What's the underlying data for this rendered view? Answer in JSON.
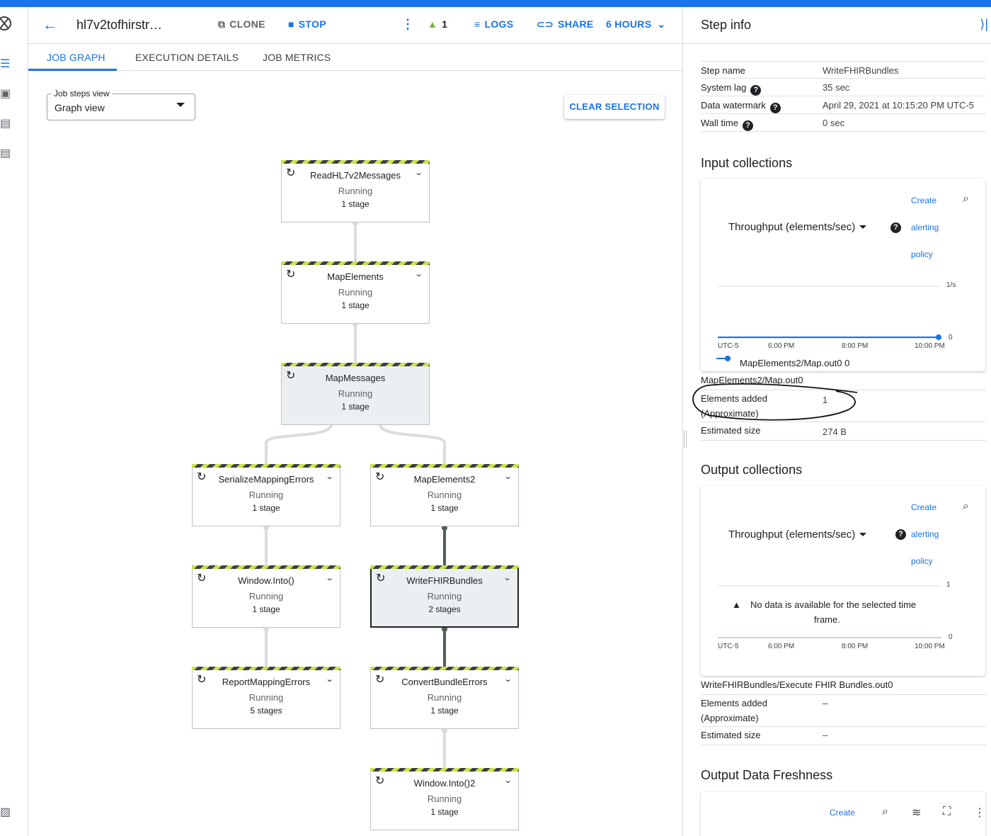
{
  "header": {
    "job_name": "hl7v2tofhirstr…",
    "clone": "CLONE",
    "stop": "STOP",
    "warning_count": "1",
    "logs": "LOGS",
    "share": "SHARE",
    "time_range": "6 HOURS"
  },
  "tabs": [
    "JOB GRAPH",
    "EXECUTION DETAILS",
    "JOB METRICS"
  ],
  "graph": {
    "view_label": "Job steps view",
    "view_value": "Graph view",
    "clear_selection": "CLEAR SELECTION",
    "nodes": [
      {
        "name": "ReadHL7v2Messages",
        "status": "Running",
        "stages": "1 stage"
      },
      {
        "name": "MapElements",
        "status": "Running",
        "stages": "1 stage"
      },
      {
        "name": "MapMessages",
        "status": "Running",
        "stages": "1 stage"
      },
      {
        "name": "SerializeMappingErrors",
        "status": "Running",
        "stages": "1 stage"
      },
      {
        "name": "MapElements2",
        "status": "Running",
        "stages": "1 stage"
      },
      {
        "name": "Window.Into()",
        "status": "Running",
        "stages": "1 stage"
      },
      {
        "name": "WriteFHIRBundles",
        "status": "Running",
        "stages": "2 stages"
      },
      {
        "name": "ReportMappingErrors",
        "status": "Running",
        "stages": "5 stages"
      },
      {
        "name": "ConvertBundleErrors",
        "status": "Running",
        "stages": "1 stage"
      },
      {
        "name": "Window.Into()2",
        "status": "Running",
        "stages": "1 stage"
      }
    ]
  },
  "step_info": {
    "title": "Step info",
    "step_name_label": "Step name",
    "step_name": "WriteFHIRBundles",
    "system_lag_label": "System lag",
    "system_lag": "35 sec",
    "watermark_label": "Data watermark",
    "watermark": "April 29, 2021 at 10:15:20 PM UTC-5",
    "wall_time_label": "Wall time",
    "wall_time": "0 sec",
    "input_title": "Input collections",
    "output_title": "Output collections",
    "freshness_title": "Output Data Freshness",
    "create": "Create",
    "alerting": "alerting",
    "policy": "policy",
    "metric": "Throughput (elements/sec)",
    "input_chart": {
      "ytop": "1/s",
      "yzero": "0",
      "ticks": [
        "UTC-5",
        "6:00 PM",
        "8:00 PM",
        "10:00 PM"
      ],
      "legend": "MapElements2/Map.out0",
      "legend_value": "0"
    },
    "output_chart": {
      "ytop": "1",
      "yzero": "0",
      "ticks": [
        "UTC-5",
        "6:00 PM",
        "8:00 PM",
        "10:00 PM"
      ],
      "nodata_1": "No data is available for the selected time",
      "nodata_2": "frame."
    },
    "in_collection": "MapElements2/Map.out0",
    "in_added_label_1": "Elements added",
    "in_added_label_2": "(Approximate)",
    "in_added": "1",
    "in_size_label": "Estimated size",
    "in_size": "274 B",
    "out_collection": "WriteFHIRBundles/Execute FHIR Bundles.out0",
    "out_added_label_1": "Elements added",
    "out_added_label_2": "(Approximate)",
    "out_added": "–",
    "out_size_label": "Estimated size",
    "out_size": "–",
    "fresh_create": "Create"
  },
  "colors": {
    "accent": "#1a73e8",
    "stripe_green": "#c6e34a",
    "stripe_dark": "#3c4043"
  }
}
